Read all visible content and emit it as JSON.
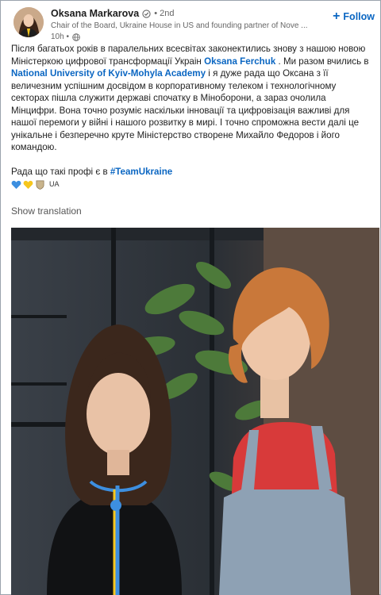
{
  "post": {
    "author": {
      "name": "Oksana Markarova",
      "degree": "• 2nd",
      "headline": "Chair of the Board, Ukraine House in US and founding partner of Nove ...",
      "time": "10h •"
    },
    "follow_label": "Follow",
    "paragraph1": {
      "t1": "Після багатьох років в паралельних всесвітах законектились знову з нашою новою Міністеркою цифрової трансформації Украін ",
      "mention1": "Oksana Ferchuk",
      "t2": " . Ми разом вчились в ",
      "mention2": "National University of Kyiv-Mohyla Academy",
      "t3": " і я дуже рада що Оксана з її величезним успішним досвідом в корпоративному телеком і технологічному секторах пішла служити державі спочатку в Міноборони, а зараз очолила Мінцифри. Вона точно розуміє наскільки інновації та цифровізація важливі для нашої перемоги у війні і нашого розвитку в мирі.  І точно спроможна вести далі це унікальне і безперечно круте Міністерство створене Михайло Федоров і його командою."
    },
    "paragraph2": {
      "t1": "Рада що такі профі є в ",
      "hashtag": "#TeamUkraine"
    },
    "emoji_label": "UA",
    "show_translation": "Show translation",
    "colors": {
      "accent": "#0a66c2",
      "heart_blue": "#3d8fe0",
      "heart_yellow": "#f6c61d"
    }
  }
}
